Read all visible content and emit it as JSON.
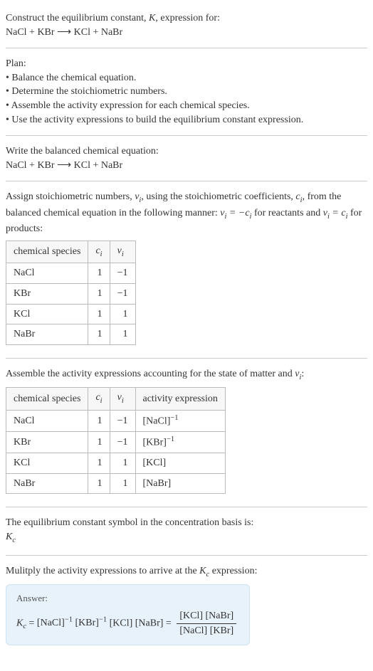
{
  "prompt": {
    "line1": "Construct the equilibrium constant, K, expression for:",
    "equation": "NaCl + KBr ⟶ KCl + NaBr"
  },
  "plan": {
    "heading": "Plan:",
    "items": [
      "Balance the chemical equation.",
      "Determine the stoichiometric numbers.",
      "Assemble the activity expression for each chemical species.",
      "Use the activity expressions to build the equilibrium constant expression."
    ]
  },
  "balanced": {
    "heading": "Write the balanced chemical equation:",
    "equation": "NaCl + KBr ⟶ KCl + NaBr"
  },
  "stoich": {
    "intro_a": "Assign stoichiometric numbers, ",
    "nu": "ν",
    "sub_i": "i",
    "intro_b": ", using the stoichiometric coefficients, ",
    "c": "c",
    "intro_c": ", from the balanced chemical equation in the following manner: ",
    "rel_reactants": "νᵢ = −cᵢ",
    "for_reactants": " for reactants and ",
    "rel_products": "νᵢ = cᵢ",
    "for_products": " for products:",
    "headers": {
      "h1": "chemical species",
      "h2": "cᵢ",
      "h3": "νᵢ"
    },
    "rows": [
      {
        "species": "NaCl",
        "c": "1",
        "nu": "−1"
      },
      {
        "species": "KBr",
        "c": "1",
        "nu": "−1"
      },
      {
        "species": "KCl",
        "c": "1",
        "nu": "1"
      },
      {
        "species": "NaBr",
        "c": "1",
        "nu": "1"
      }
    ]
  },
  "activity": {
    "heading": "Assemble the activity expressions accounting for the state of matter and νᵢ:",
    "headers": {
      "h1": "chemical species",
      "h2": "cᵢ",
      "h3": "νᵢ",
      "h4": "activity expression"
    },
    "rows": [
      {
        "species": "NaCl",
        "c": "1",
        "nu": "−1",
        "expr": "[NaCl]⁻¹"
      },
      {
        "species": "KBr",
        "c": "1",
        "nu": "−1",
        "expr": "[KBr]⁻¹"
      },
      {
        "species": "KCl",
        "c": "1",
        "nu": "1",
        "expr": "[KCl]"
      },
      {
        "species": "NaBr",
        "c": "1",
        "nu": "1",
        "expr": "[NaBr]"
      }
    ]
  },
  "symbol": {
    "heading": "The equilibrium constant symbol in the concentration basis is:",
    "value": "K",
    "sub": "c"
  },
  "multiply": {
    "heading_a": "Mulitply the activity expressions to arrive at the ",
    "Kc_K": "K",
    "Kc_c": "c",
    "heading_b": " expression:"
  },
  "answer": {
    "label": "Answer:",
    "Kc_K": "K",
    "Kc_c": "c",
    "eq": " = ",
    "t1": "[NaCl]⁻¹ ",
    "t2": "[KBr]⁻¹ ",
    "t3": "[KCl] ",
    "t4": "[NaBr] ",
    "frac_num": "[KCl] [NaBr]",
    "frac_den": "[NaCl] [KBr]"
  }
}
